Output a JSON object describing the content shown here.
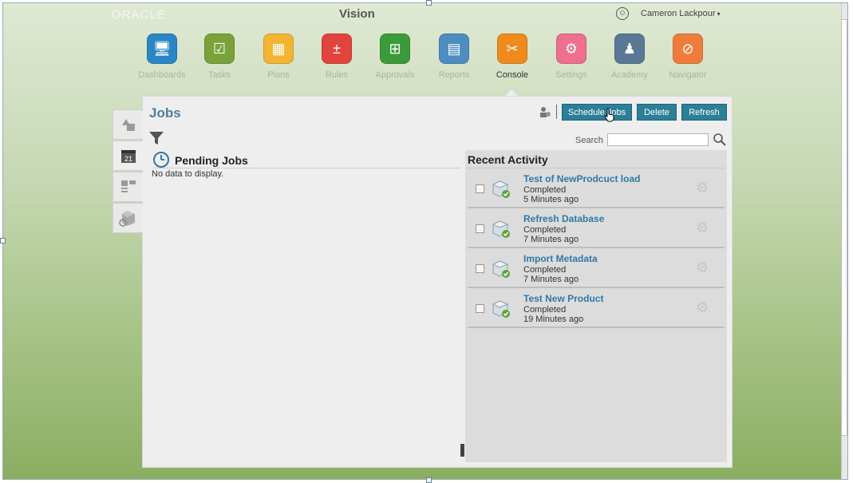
{
  "header": {
    "logo": "ORACLE",
    "app_name": "Vision",
    "user_name": "Cameron Lackpour",
    "user_caret": "▾"
  },
  "nav": {
    "items": [
      {
        "label": "Dashboards",
        "color": "#2a86c4",
        "glyph": "🖥"
      },
      {
        "label": "Tasks",
        "color": "#7aa23a",
        "glyph": "☑"
      },
      {
        "label": "Plans",
        "color": "#f3b531",
        "glyph": "▦"
      },
      {
        "label": "Rules",
        "color": "#e0443c",
        "glyph": "±"
      },
      {
        "label": "Approvals",
        "color": "#3b9b3a",
        "glyph": "⊞"
      },
      {
        "label": "Reports",
        "color": "#4d8dc2",
        "glyph": "▤"
      },
      {
        "label": "Console",
        "color": "#ef8a1c",
        "glyph": "✂"
      },
      {
        "label": "Settings",
        "color": "#ef6f8e",
        "glyph": "⚙"
      },
      {
        "label": "Academy",
        "color": "#5a7896",
        "glyph": "♟"
      },
      {
        "label": "Navigator",
        "color": "#ef7c3a",
        "glyph": "⊘"
      }
    ],
    "active": "Console"
  },
  "jobs": {
    "title": "Jobs",
    "pending_title": "Pending Jobs",
    "no_data": "No data to display.",
    "buttons": {
      "schedule": "Schedule Jobs",
      "delete": "Delete",
      "refresh": "Refresh"
    },
    "search_label": "Search",
    "search_value": ""
  },
  "recent_activity": {
    "title": "Recent Activity",
    "items": [
      {
        "name": "Test of NewProdcuct load",
        "status": "Completed",
        "time": "5 Minutes ago"
      },
      {
        "name": "Refresh Database",
        "status": "Completed",
        "time": "7 Minutes ago"
      },
      {
        "name": "Import Metadata",
        "status": "Completed",
        "time": "7 Minutes ago"
      },
      {
        "name": "Test New Product",
        "status": "Completed",
        "time": "19 Minutes ago"
      }
    ]
  },
  "sidetabs": {
    "calendar_day": "21"
  }
}
